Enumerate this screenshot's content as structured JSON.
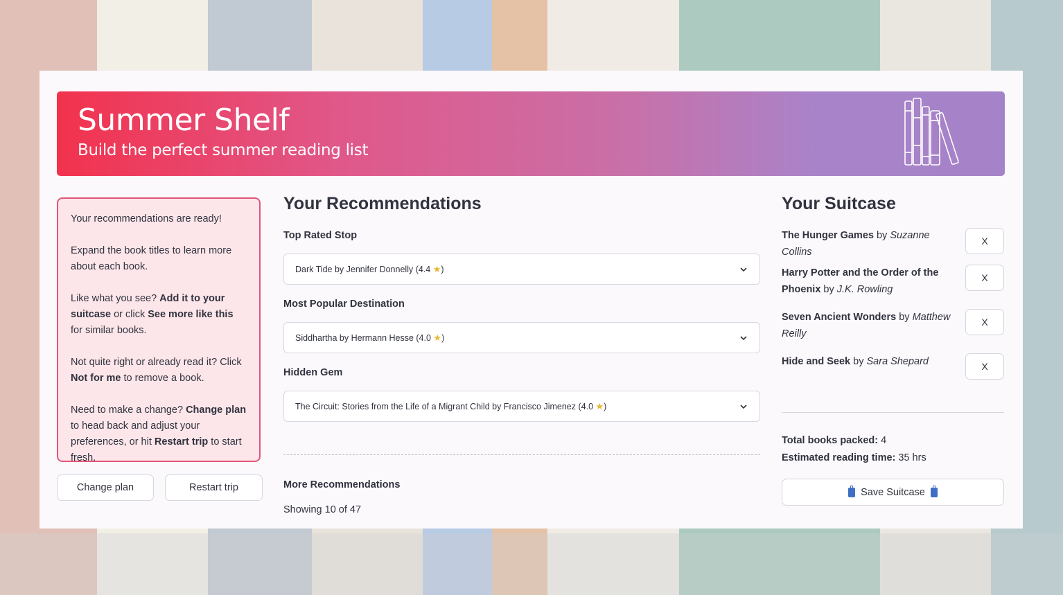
{
  "banner": {
    "title": "Summer Shelf",
    "subtitle": "Build the perfect summer reading list"
  },
  "info": {
    "p1": "Your recommendations are ready!",
    "p2": "Expand the book titles to learn more about each book.",
    "p3_pre": "Like what you see? ",
    "p3_b1": "Add it to your suitcase",
    "p3_mid": " or click ",
    "p3_b2": "See more like this",
    "p3_post": " for similar books.",
    "p4_pre": "Not quite right or already read it? Click ",
    "p4_b": "Not for me",
    "p4_post": " to remove a book.",
    "p5_pre": "Need to make a change? ",
    "p5_b1": "Change plan",
    "p5_mid": " to head back and adjust your preferences, or hit ",
    "p5_b2": "Restart trip",
    "p5_post": " to start fresh."
  },
  "buttons": {
    "change_plan": "Change plan",
    "restart_trip": "Restart trip"
  },
  "recommendations": {
    "title": "Your Recommendations",
    "sections": [
      {
        "label": "Top Rated Stop",
        "book": "Dark Tide by Jennifer Donnelly (4.4",
        "close": ")"
      },
      {
        "label": "Most Popular Destination",
        "book": "Siddhartha by Hermann Hesse (4.0",
        "close": ")"
      },
      {
        "label": "Hidden Gem",
        "book": "The Circuit: Stories from the Life of a Migrant Child by Francisco Jimenez (4.0",
        "close": ")"
      }
    ],
    "star_glyph": "★",
    "more_label": "More Recommendations",
    "showing": "Showing 10 of 47"
  },
  "suitcase": {
    "title": "Your Suitcase",
    "items": [
      {
        "title": "The Hunger Games",
        "by": " by ",
        "author": "Suzanne Collins"
      },
      {
        "title": "Harry Potter and the Order of the Phoenix",
        "by": " by ",
        "author": "J.K. Rowling"
      },
      {
        "title": "Seven Ancient Wonders",
        "by": " by ",
        "author": "Matthew Reilly"
      },
      {
        "title": "Hide and Seek",
        "by": " by ",
        "author": "Sara Shepard"
      }
    ],
    "remove_label": "X",
    "total_label": "Total books packed:",
    "total_value": " 4",
    "time_label": "Estimated reading time:",
    "time_value": " 35 hrs",
    "save_label": "Save Suitcase"
  },
  "colors": {
    "accent_border": "#e0567a",
    "info_bg": "#fde6ea",
    "banner_start": "#f2324d",
    "banner_end": "#a583c8",
    "star": "#e9b62f",
    "suitcase_icon": "#3f6fc4"
  },
  "icons": [
    "books-icon",
    "chevron-down-icon",
    "star-icon",
    "suitcase-icon"
  ]
}
